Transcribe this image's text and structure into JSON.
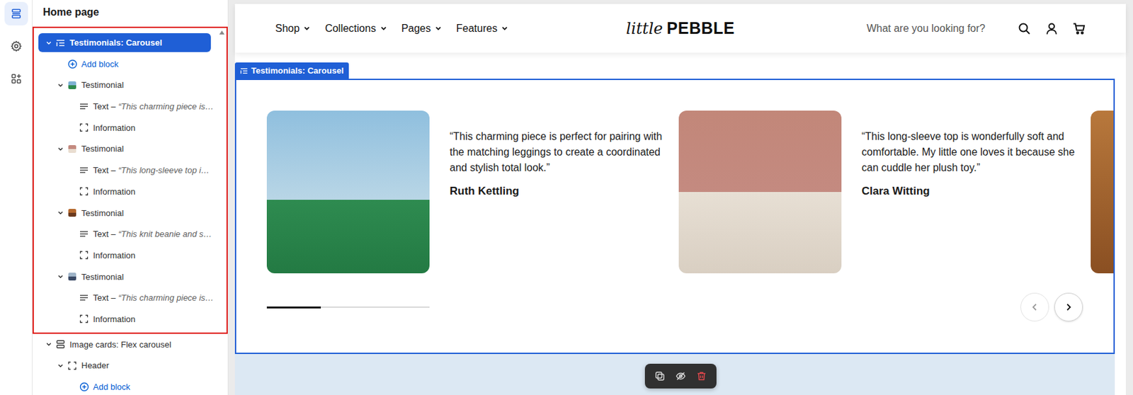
{
  "rail": [
    {
      "kind": "sections",
      "selected": true
    },
    {
      "kind": "settings",
      "selected": false
    },
    {
      "kind": "apps",
      "selected": false
    }
  ],
  "sidebar": {
    "title": "Home page",
    "sections": [
      {
        "kind": "testimonials",
        "label": "Testimonials: Carousel",
        "selected": true,
        "expanded": true,
        "outlined": true,
        "children": [
          {
            "kind": "add",
            "label": "Add block"
          },
          {
            "kind": "block",
            "label": "Testimonial",
            "expanded": true,
            "children": [
              {
                "kind": "text",
                "label": "Text –",
                "preview": "“This charming piece is…"
              },
              {
                "kind": "group",
                "label": "Information"
              }
            ]
          },
          {
            "kind": "block",
            "label": "Testimonial",
            "expanded": true,
            "children": [
              {
                "kind": "text",
                "label": "Text –",
                "preview": "“This long-sleeve top i…"
              },
              {
                "kind": "group",
                "label": "Information"
              }
            ]
          },
          {
            "kind": "block",
            "label": "Testimonial",
            "expanded": true,
            "children": [
              {
                "kind": "text",
                "label": "Text –",
                "preview": "“This knit beanie and s…"
              },
              {
                "kind": "group",
                "label": "Information"
              }
            ]
          },
          {
            "kind": "block",
            "label": "Testimonial",
            "expanded": true,
            "children": [
              {
                "kind": "text",
                "label": "Text –",
                "preview": "“This charming piece is…"
              },
              {
                "kind": "group",
                "label": "Information"
              }
            ]
          }
        ]
      },
      {
        "kind": "cards",
        "label": "Image cards: Flex carousel",
        "selected": false,
        "expanded": true,
        "outlined": false,
        "children": [
          {
            "kind": "group",
            "label": "Header",
            "expanded": true,
            "children": [
              {
                "kind": "add",
                "label": "Add block"
              }
            ]
          }
        ]
      }
    ]
  },
  "store": {
    "nav": [
      {
        "label": "Shop"
      },
      {
        "label": "Collections"
      },
      {
        "label": "Pages"
      },
      {
        "label": "Features"
      }
    ],
    "logo": {
      "script": "little",
      "bold": "PEBBLE"
    },
    "search": {
      "placeholder": "What are you looking for?"
    }
  },
  "section": {
    "tag": "Testimonials: Carousel",
    "selected": true,
    "testimonials": [
      {
        "quote": "“This charming piece is perfect for pairing with the matching leggings to create a coordinated and stylish total look.”",
        "name": "Ruth Kettling"
      },
      {
        "quote": "“This long-sleeve top is wonderfully soft and comfortable. My little one loves it because she can cuddle her plush toy.”",
        "name": "Clara Witting"
      },
      {
        "quote": "",
        "name": ""
      }
    ],
    "progress": {
      "level": 0.33
    },
    "prev": {
      "disabled": true
    },
    "next": {
      "disabled": false
    }
  },
  "toolbar": [
    {
      "kind": "duplicate"
    },
    {
      "kind": "hide"
    },
    {
      "kind": "delete"
    }
  ]
}
